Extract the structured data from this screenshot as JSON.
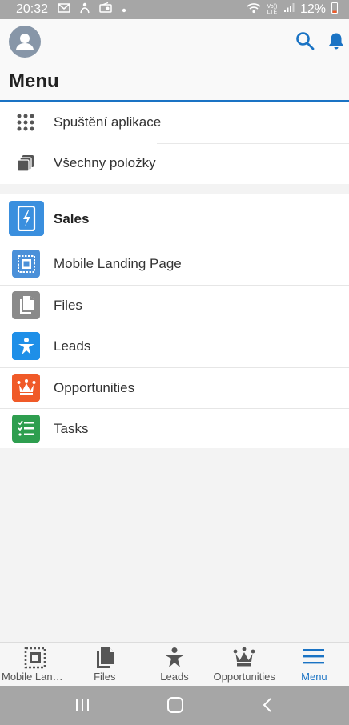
{
  "status_bar": {
    "time": "20:32",
    "battery": "12%",
    "network": "Vo)) LTE"
  },
  "header": {
    "title": "Menu"
  },
  "launcher": {
    "items": [
      {
        "label": "Spuštění aplikace",
        "icon": "app-launcher-icon"
      },
      {
        "label": "Všechny položky",
        "icon": "all-items-icon"
      }
    ]
  },
  "sales": {
    "title": "Sales",
    "items": [
      {
        "label": "Mobile Landing Page",
        "icon": "landing-page-icon",
        "color": "#4a90d9"
      },
      {
        "label": "Files",
        "icon": "files-icon",
        "color": "#8a8a8a"
      },
      {
        "label": "Leads",
        "icon": "leads-icon",
        "color": "#1e8fe8"
      },
      {
        "label": "Opportunities",
        "icon": "opportunities-icon",
        "color": "#f05a28"
      },
      {
        "label": "Tasks",
        "icon": "tasks-icon",
        "color": "#2e9e4f"
      }
    ]
  },
  "bottom_nav": {
    "items": [
      {
        "label": "Mobile Landi...",
        "icon": "landing-page-icon"
      },
      {
        "label": "Files",
        "icon": "files-icon"
      },
      {
        "label": "Leads",
        "icon": "leads-icon"
      },
      {
        "label": "Opportunities",
        "icon": "opportunities-icon"
      },
      {
        "label": "Menu",
        "icon": "hamburger-menu-icon",
        "active": true
      }
    ]
  },
  "colors": {
    "accent": "#1a73c4",
    "sales_tile": "#3a8fde"
  }
}
